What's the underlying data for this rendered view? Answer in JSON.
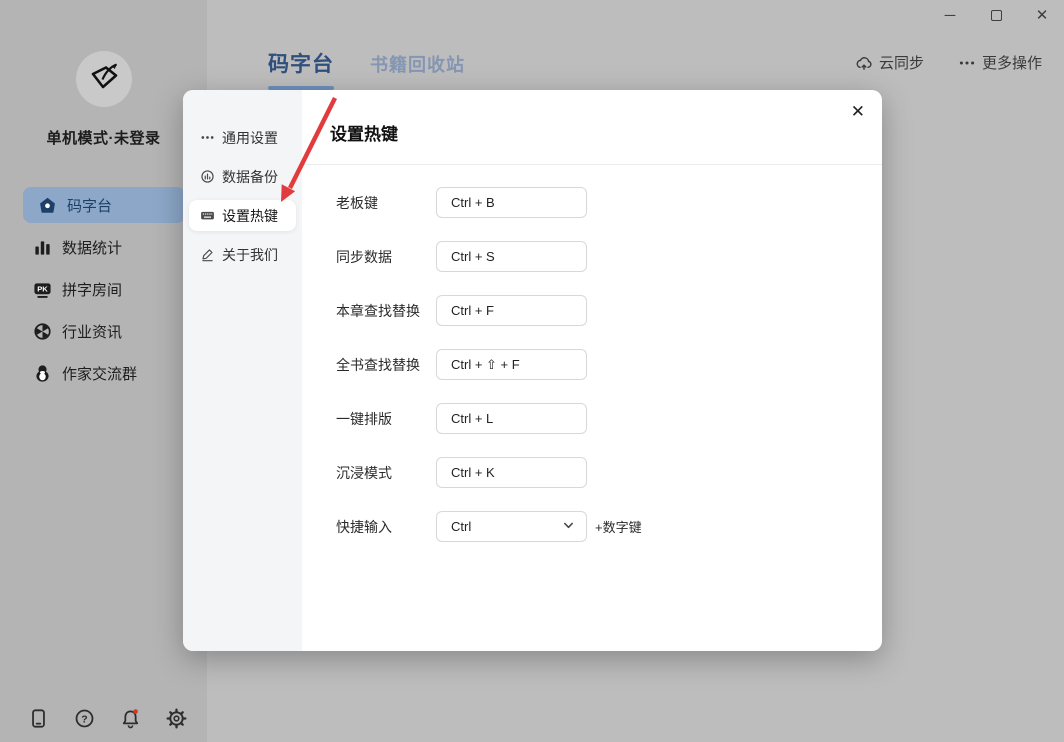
{
  "colors": {
    "sidebar-bg": "#b4b4b4",
    "main-bg": "#bdbdbd",
    "pill-bg": "#8ca7c8",
    "pill-fg": "#1e4067",
    "tab-active": "#2f4f7d",
    "tab-underline": "#6e90bd",
    "tab-inactive": "#8496b3",
    "modal-nav-bg": "#f4f5f6",
    "arrow": "#e23b3d",
    "dot": "#d3382c"
  },
  "window_controls": {
    "minimize": "─",
    "close": "✕"
  },
  "sidebar": {
    "user_status": "单机模式·未登录",
    "items": [
      {
        "label": "码字台",
        "icon": "home-icon",
        "active": true
      },
      {
        "label": "数据统计",
        "icon": "bar-chart-icon",
        "active": false
      },
      {
        "label": "拼字房间",
        "icon": "pk-badge-icon",
        "active": false
      },
      {
        "label": "行业资讯",
        "icon": "aperture-icon",
        "active": false
      },
      {
        "label": "作家交流群",
        "icon": "penguin-icon",
        "active": false
      }
    ],
    "footer_icons": [
      "mobile-icon",
      "help-icon",
      "bell-icon",
      "gear-icon"
    ]
  },
  "header": {
    "tabs": [
      {
        "label": "码字台",
        "active": true
      },
      {
        "label": "书籍回收站",
        "active": false
      }
    ],
    "actions": [
      {
        "label": "云同步",
        "icon": "cloud-sync-icon"
      },
      {
        "label": "更多操作",
        "icon": "more-dots-icon"
      }
    ]
  },
  "modal": {
    "title": "设置热键",
    "close_label": "✕",
    "nav": [
      {
        "label": "通用设置",
        "icon": "dots-icon",
        "active": false
      },
      {
        "label": "数据备份",
        "icon": "backup-icon",
        "active": false
      },
      {
        "label": "设置热键",
        "icon": "keyboard-icon",
        "active": true
      },
      {
        "label": "关于我们",
        "icon": "pen-icon",
        "active": false
      }
    ],
    "rows": [
      {
        "label": "老板键",
        "value": "Ctrl + B",
        "type": "input"
      },
      {
        "label": "同步数据",
        "value": "Ctrl + S",
        "type": "input"
      },
      {
        "label": "本章查找替换",
        "value": "Ctrl + F",
        "type": "input"
      },
      {
        "label": "全书查找替换",
        "value": "Ctrl + ⇧ + F",
        "type": "input"
      },
      {
        "label": "一键排版",
        "value": "Ctrl + L",
        "type": "input"
      },
      {
        "label": "沉浸模式",
        "value": "Ctrl + K",
        "type": "input"
      },
      {
        "label": "快捷输入",
        "value": "Ctrl",
        "type": "select",
        "suffix": "+数字键"
      }
    ]
  }
}
